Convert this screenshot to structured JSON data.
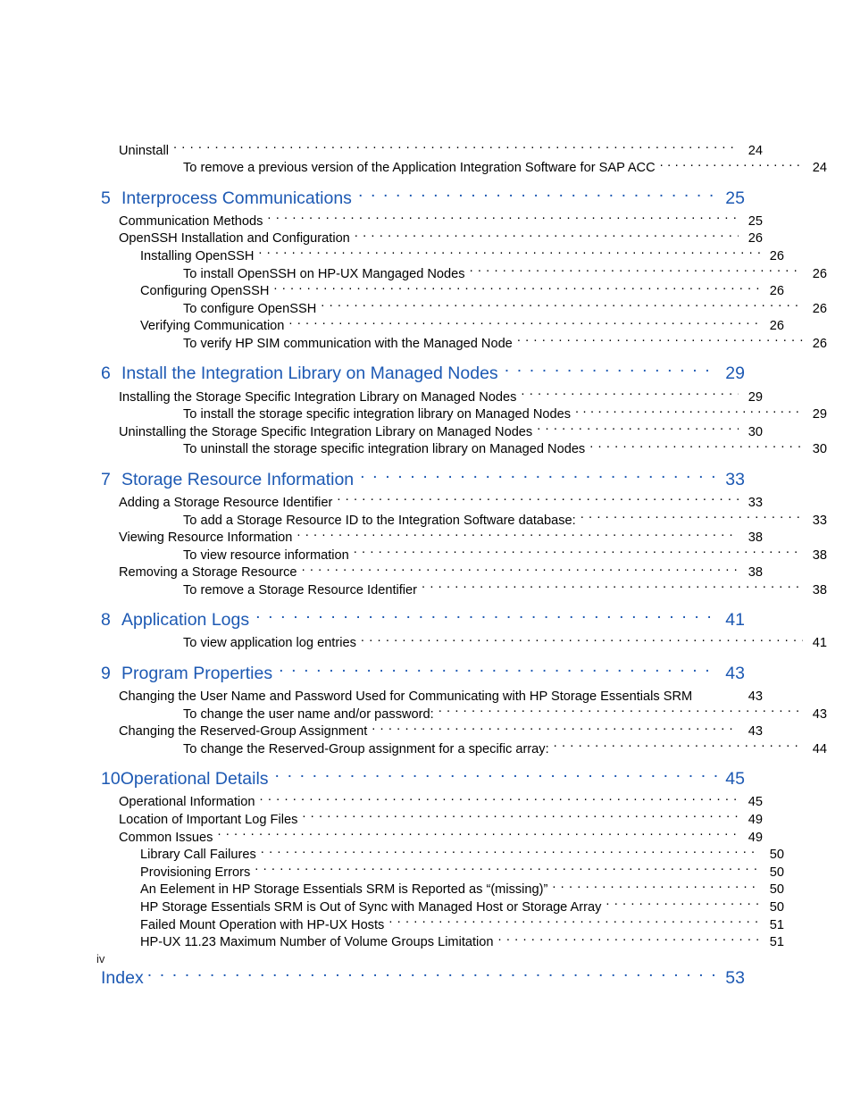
{
  "page": {
    "folio": "iv",
    "accent_color": "#1d59b3",
    "text_color": "#000000"
  },
  "entries": [
    {
      "level": "lvl1",
      "number": "",
      "label": "Uninstall",
      "page": "24",
      "leader": "normal"
    },
    {
      "level": "lvl3",
      "number": "",
      "label": "To remove a previous version of the Application Integration Software for SAP ACC",
      "page": "24",
      "leader": "tight"
    },
    {
      "level": "chapter",
      "number": "5",
      "label": "Interprocess Communications",
      "page": "25",
      "leader": "normal"
    },
    {
      "level": "lvl1",
      "number": "",
      "label": "Communication Methods",
      "page": "25",
      "leader": "normal"
    },
    {
      "level": "lvl1",
      "number": "",
      "label": "OpenSSH Installation and Configuration",
      "page": "26",
      "leader": "normal"
    },
    {
      "level": "lvl2",
      "number": "",
      "label": "Installing OpenSSH",
      "page": "26",
      "leader": "normal"
    },
    {
      "level": "lvl3",
      "number": "",
      "label": "To install OpenSSH on HP-UX Mangaged Nodes",
      "page": "26",
      "leader": "normal"
    },
    {
      "level": "lvl2",
      "number": "",
      "label": "Configuring OpenSSH",
      "page": "26",
      "leader": "normal"
    },
    {
      "level": "lvl3",
      "number": "",
      "label": "To configure OpenSSH",
      "page": "26",
      "leader": "normal"
    },
    {
      "level": "lvl2",
      "number": "",
      "label": "Verifying Communication",
      "page": "26",
      "leader": "normal"
    },
    {
      "level": "lvl3",
      "number": "",
      "label": "To verify HP SIM communication with the Managed Node",
      "page": "26",
      "leader": "normal"
    },
    {
      "level": "chapter",
      "number": "6",
      "label": "Install the Integration Library on Managed Nodes",
      "page": "29",
      "leader": "normal"
    },
    {
      "level": "lvl1",
      "number": "",
      "label": "Installing the Storage Specific Integration Library on Managed Nodes",
      "page": "29",
      "leader": "normal"
    },
    {
      "level": "lvl3",
      "number": "",
      "label": "To install the storage specific integration library on Managed Nodes",
      "page": "29",
      "leader": "tight"
    },
    {
      "level": "lvl1",
      "number": "",
      "label": "Uninstalling the Storage Specific Integration Library on Managed Nodes",
      "page": "30",
      "leader": "normal"
    },
    {
      "level": "lvl3",
      "number": "",
      "label": "To uninstall the storage specific integration library on Managed Nodes",
      "page": "30",
      "leader": "normal"
    },
    {
      "level": "chapter",
      "number": "7",
      "label": "Storage Resource Information",
      "page": "33",
      "leader": "normal"
    },
    {
      "level": "lvl1",
      "number": "",
      "label": "Adding a Storage Resource Identifier",
      "page": "33",
      "leader": "normal"
    },
    {
      "level": "lvl3",
      "number": "",
      "label": "To add a Storage Resource ID to the Integration Software database:",
      "page": "33",
      "leader": "normal"
    },
    {
      "level": "lvl1",
      "number": "",
      "label": "Viewing Resource Information",
      "page": "38",
      "leader": "normal"
    },
    {
      "level": "lvl3",
      "number": "",
      "label": "To view resource information",
      "page": "38",
      "leader": "normal"
    },
    {
      "level": "lvl1",
      "number": "",
      "label": "Removing a Storage Resource",
      "page": "38",
      "leader": "normal"
    },
    {
      "level": "lvl3",
      "number": "",
      "label": "To remove a Storage Resource Identifier",
      "page": "38",
      "leader": "normal"
    },
    {
      "level": "chapter",
      "number": "8",
      "label": "Application Logs",
      "page": "41",
      "leader": "normal"
    },
    {
      "level": "lvl3",
      "number": "",
      "label": "To view application log entries",
      "page": "41",
      "leader": "normal"
    },
    {
      "level": "chapter",
      "number": "9",
      "label": "Program Properties",
      "page": "43",
      "leader": "normal"
    },
    {
      "level": "lvl1",
      "number": "",
      "label": "Changing the User Name and Password Used for Communicating with HP Storage Essentials SRM",
      "page": "43",
      "leader": "none"
    },
    {
      "level": "lvl3",
      "number": "",
      "label": "To change the user name and/or password:",
      "page": "43",
      "leader": "normal"
    },
    {
      "level": "lvl1",
      "number": "",
      "label": "Changing the Reserved-Group Assignment",
      "page": "43",
      "leader": "normal"
    },
    {
      "level": "lvl3",
      "number": "",
      "label": "To change the Reserved-Group assignment for a specific array:",
      "page": "44",
      "leader": "normal"
    },
    {
      "level": "chapter",
      "number": "10",
      "label": "Operational Details",
      "page": "45",
      "leader": "normal"
    },
    {
      "level": "lvl1",
      "number": "",
      "label": "Operational Information",
      "page": "45",
      "leader": "normal"
    },
    {
      "level": "lvl1",
      "number": "",
      "label": "Location of Important Log Files",
      "page": "49",
      "leader": "normal"
    },
    {
      "level": "lvl1",
      "number": "",
      "label": "Common Issues",
      "page": "49",
      "leader": "normal"
    },
    {
      "level": "lvl2",
      "number": "",
      "label": "Library Call Failures",
      "page": "50",
      "leader": "normal"
    },
    {
      "level": "lvl2",
      "number": "",
      "label": "Provisioning Errors",
      "page": "50",
      "leader": "normal"
    },
    {
      "level": "lvl2",
      "number": "",
      "label": "An Eelement in HP Storage Essentials SRM is Reported as “(missing)”",
      "page": "50",
      "leader": "normal"
    },
    {
      "level": "lvl2",
      "number": "",
      "label": "HP Storage Essentials SRM is Out of Sync with Managed Host or Storage Array",
      "page": "50",
      "leader": "normal"
    },
    {
      "level": "lvl2",
      "number": "",
      "label": "Failed Mount Operation with HP-UX Hosts",
      "page": "51",
      "leader": "normal"
    },
    {
      "level": "lvl2",
      "number": "",
      "label": "HP-UX 11.23  Maximum Number of Volume Groups Limitation",
      "page": "51",
      "leader": "normal"
    },
    {
      "level": "index",
      "number": "",
      "label": "Index",
      "page": "53",
      "leader": "normal"
    }
  ]
}
